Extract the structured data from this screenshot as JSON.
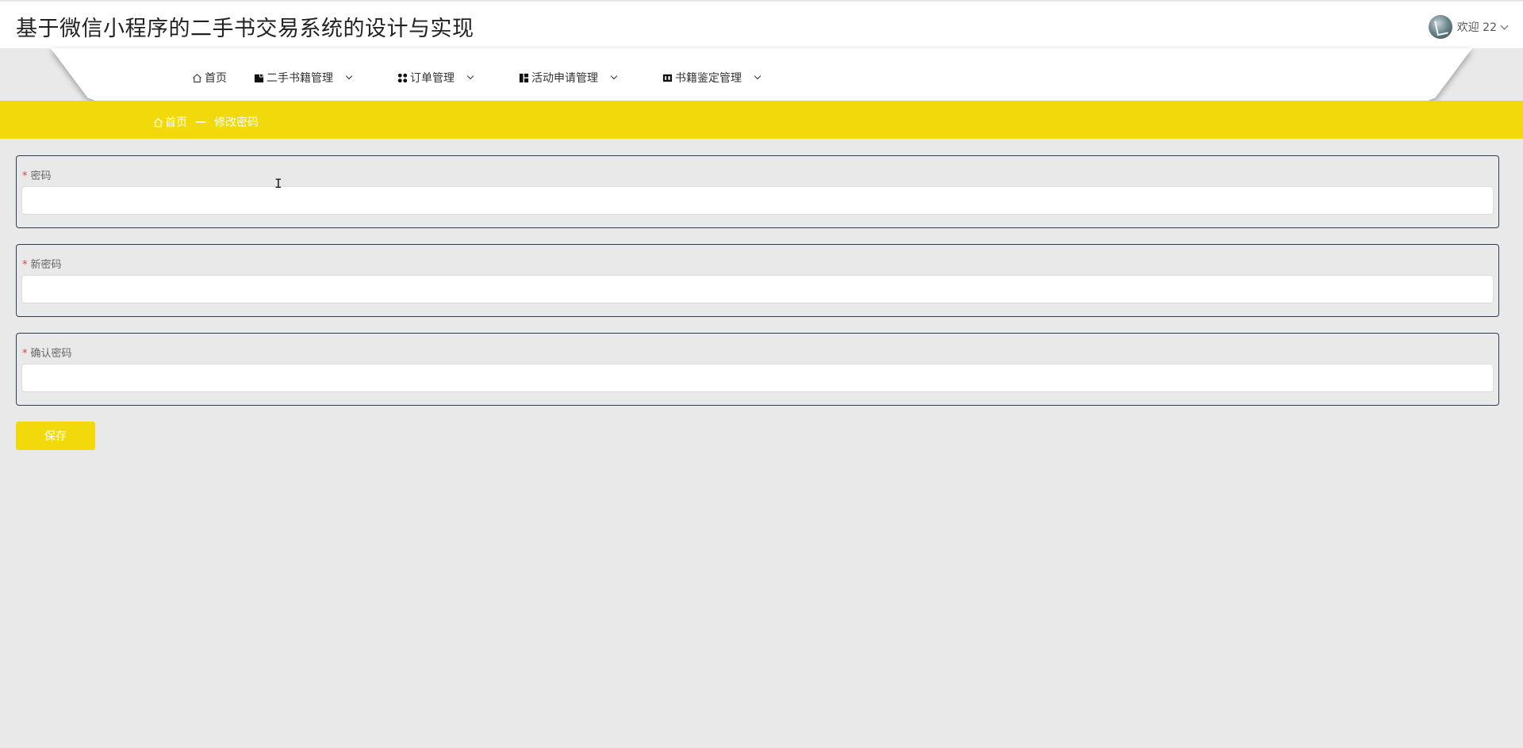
{
  "header": {
    "title": "基于微信小程序的二手书交易系统的设计与实现",
    "user_greeting": "欢迎 22"
  },
  "nav": {
    "items": [
      {
        "label": "首页",
        "icon": "home-icon",
        "has_dropdown": false
      },
      {
        "label": "二手书籍管理",
        "icon": "book-manage-icon",
        "has_dropdown": true
      },
      {
        "label": "订单管理",
        "icon": "order-grid-icon",
        "has_dropdown": true
      },
      {
        "label": "活动申请管理",
        "icon": "activity-layout-icon",
        "has_dropdown": true
      },
      {
        "label": "书籍鉴定管理",
        "icon": "appraisal-icon",
        "has_dropdown": true
      }
    ]
  },
  "breadcrumb": {
    "home": "首页",
    "separator": "—",
    "current": "修改密码"
  },
  "form": {
    "fields": [
      {
        "label": "密码",
        "required": true,
        "value": "",
        "placeholder": ""
      },
      {
        "label": "新密码",
        "required": true,
        "value": "",
        "placeholder": ""
      },
      {
        "label": "确认密码",
        "required": true,
        "value": "",
        "placeholder": ""
      }
    ],
    "required_mark": "*",
    "save_label": "保存"
  },
  "colors": {
    "accent": "#f2d90b",
    "page_bg": "#e9e9e9",
    "card_border": "#2d3f55",
    "required": "#e04040"
  }
}
